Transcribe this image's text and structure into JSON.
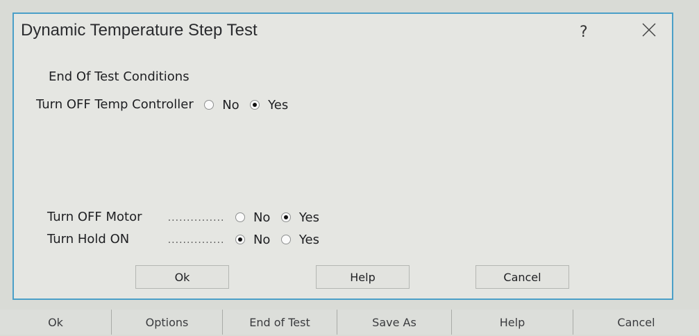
{
  "dialog": {
    "title": "Dynamic Temperature Step Test",
    "help_icon": "question-mark",
    "close_icon": "close-x",
    "section_heading": "End Of Test Conditions",
    "options": [
      {
        "label": "Turn OFF Temp Controller",
        "leader": "",
        "no": "No",
        "yes": "Yes",
        "selected": "Yes"
      },
      {
        "label": "Turn OFF Motor",
        "leader": "...............",
        "no": "No",
        "yes": "Yes",
        "selected": "Yes"
      },
      {
        "label": "Turn Hold ON",
        "leader": "...............",
        "no": "No",
        "yes": "Yes",
        "selected": "No"
      }
    ],
    "buttons": {
      "ok": "Ok",
      "help": "Help",
      "cancel": "Cancel"
    }
  },
  "taskbar": {
    "buttons": [
      "Ok",
      "Options",
      "End of Test",
      "Save As",
      "Help",
      "Cancel"
    ]
  }
}
